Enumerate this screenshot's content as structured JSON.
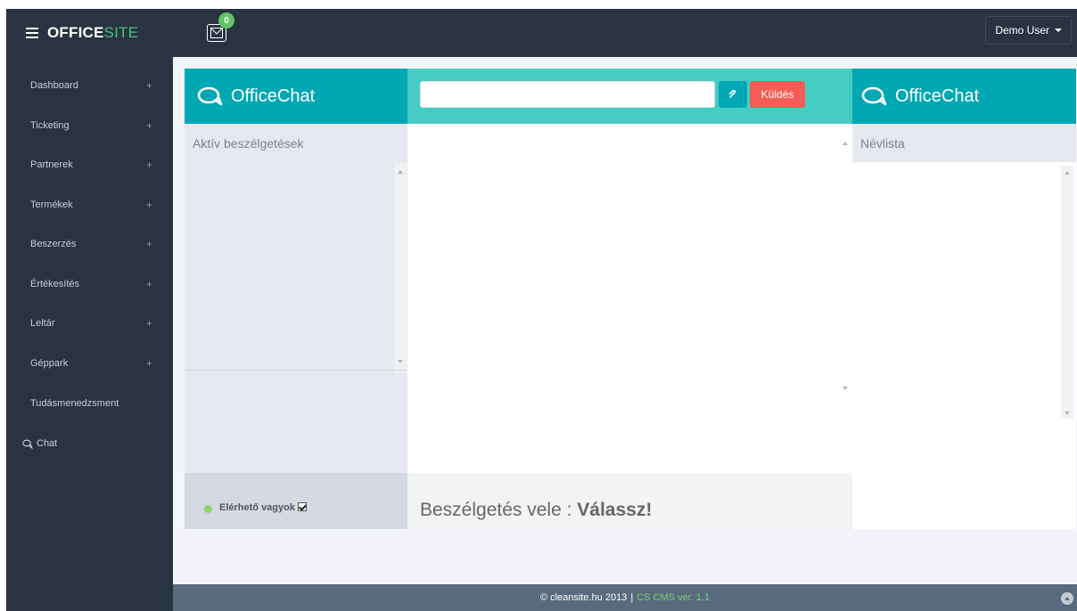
{
  "app": {
    "brand_main": "OFFICE",
    "brand_accent": "SITE",
    "mail_count": "0",
    "user_label": "Demo User"
  },
  "sidebar": {
    "items": [
      {
        "label": "Dashboard"
      },
      {
        "label": "Ticketing"
      },
      {
        "label": "Partnerek"
      },
      {
        "label": "Termékek"
      },
      {
        "label": "Beszerzés"
      },
      {
        "label": "Értékesítés"
      },
      {
        "label": "Leltár"
      },
      {
        "label": "Géppark"
      },
      {
        "label": "Tudásmenedzsment"
      },
      {
        "label": "Chat"
      }
    ],
    "expand_symbol": "+"
  },
  "chat": {
    "title_left": "OfficeChat",
    "title_right": "OfficeChat",
    "active_conversations_label": "Aktív beszélgetések",
    "message_input_value": "",
    "send_label": "Küldés",
    "name_list_label": "Névlista",
    "status_label": "Elérhető vagyok",
    "conversation_prefix": "Beszélgetés vele : ",
    "conversation_target": "Válassz!"
  },
  "footer": {
    "copyright": "© cleansite.hu 2013",
    "separator": "|",
    "version": "CS CMS ver. 1.1"
  },
  "colors": {
    "topbar": "#2a3340",
    "brand_accent": "#47c27a",
    "chat_header": "#00a8b4",
    "chat_input_bar": "#47ccc4",
    "send_button": "#f45c55",
    "footer": "#5a6a7e"
  }
}
